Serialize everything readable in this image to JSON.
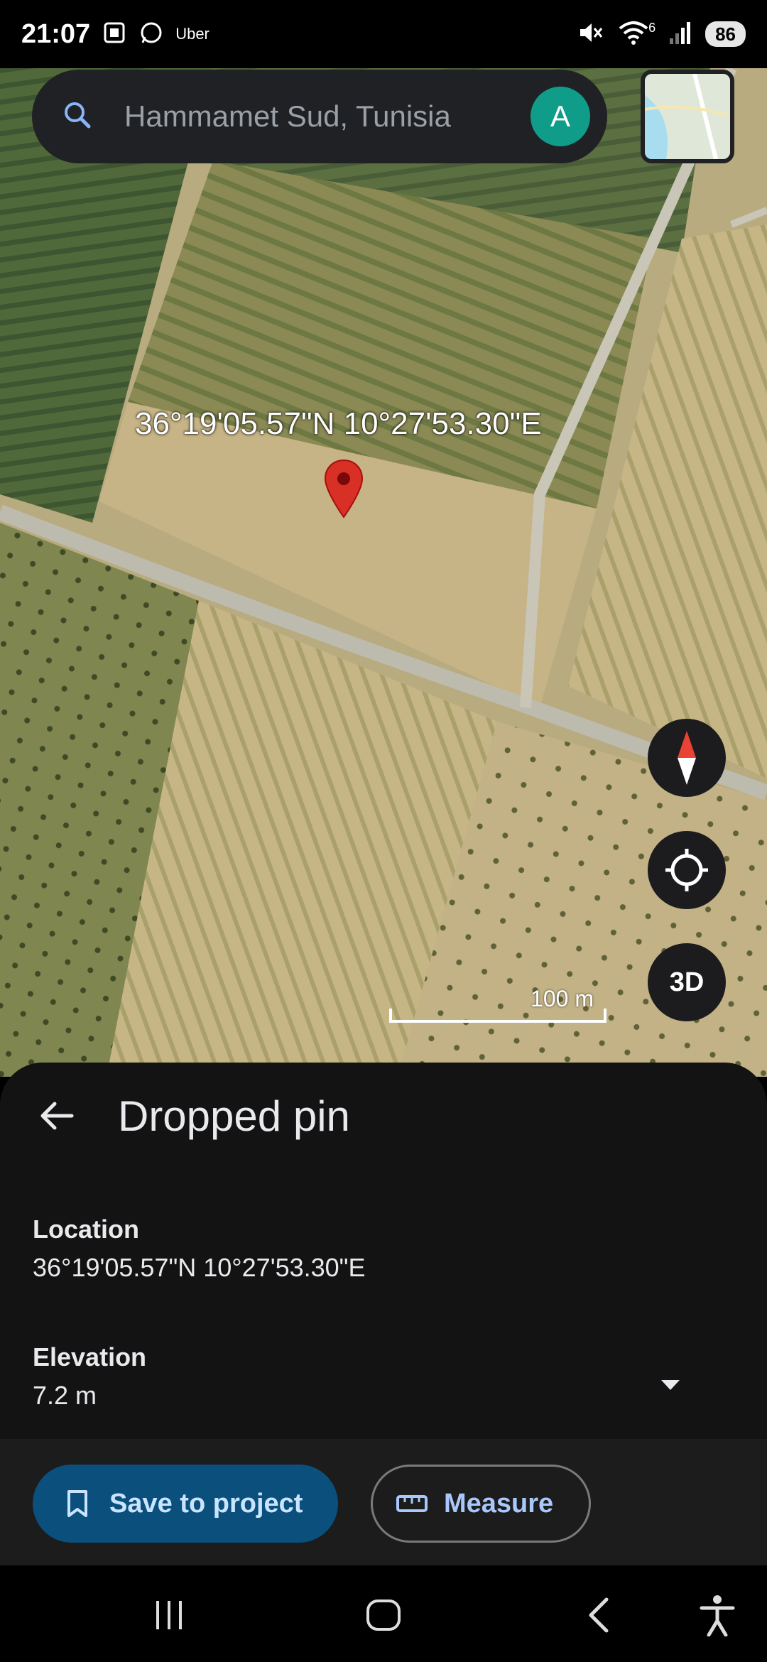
{
  "status_bar": {
    "time": "21:07",
    "app_label": "Uber",
    "wifi_badge": "6",
    "battery": "86"
  },
  "search": {
    "placeholder": "Hammamet Sud, Tunisia",
    "avatar_letter": "A"
  },
  "map": {
    "coordinate_label": "36°19'05.57\"N 10°27'53.30\"E",
    "scale_label": "100 m",
    "threed_label": "3D"
  },
  "sheet": {
    "title": "Dropped pin",
    "location_label": "Location",
    "location_value": "36°19'05.57\"N 10°27'53.30\"E",
    "elevation_label": "Elevation",
    "elevation_value": "7.2 m"
  },
  "actions": {
    "save_label": "Save to project",
    "measure_label": "Measure"
  },
  "colors": {
    "pin": "#d93025",
    "save_button": "#0b4f7c",
    "avatar": "#0f9d8a"
  }
}
